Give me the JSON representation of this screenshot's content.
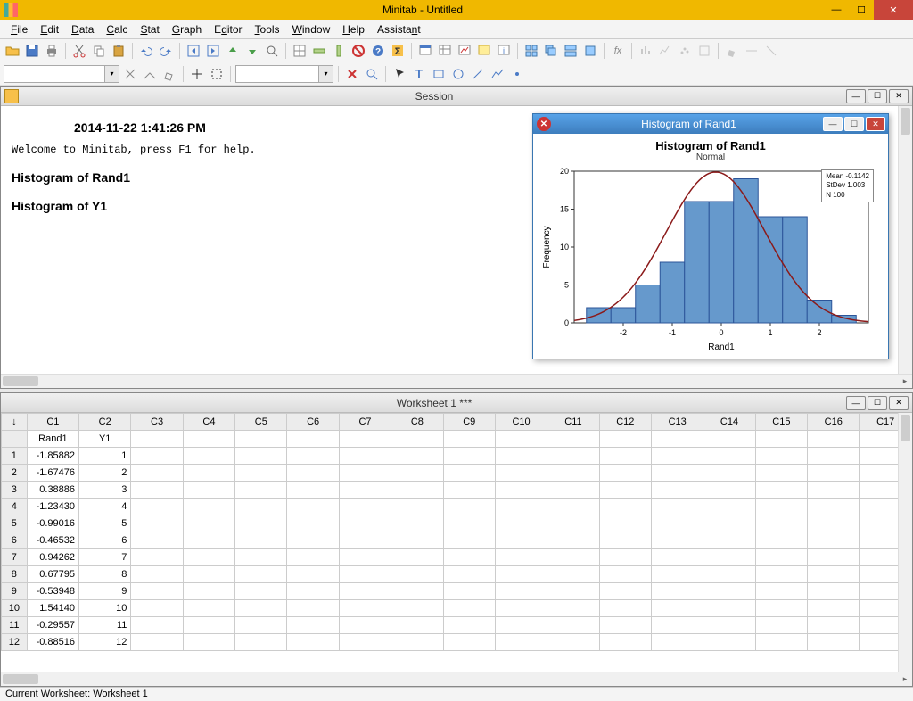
{
  "app": {
    "title": "Minitab - Untitled"
  },
  "menu": [
    "File",
    "Edit",
    "Data",
    "Calc",
    "Stat",
    "Graph",
    "Editor",
    "Tools",
    "Window",
    "Help",
    "Assistant"
  ],
  "session": {
    "title": "Session",
    "timestamp": "2014-11-22 1:41:26 PM",
    "welcome": "Welcome to Minitab, press F1 for help.",
    "h1": "Histogram of Rand1",
    "h2": "Histogram of Y1"
  },
  "chart_window": {
    "title": "Histogram of Rand1"
  },
  "chart_data": {
    "type": "bar",
    "title": "Histogram of Rand1",
    "subtitle": "Normal",
    "xlabel": "Rand1",
    "ylabel": "Frequency",
    "ylim": [
      0,
      20
    ],
    "yticks": [
      0,
      5,
      10,
      15,
      20
    ],
    "xticks": [
      -2,
      -1,
      0,
      1,
      2
    ],
    "categories": [
      -2.5,
      -2.0,
      -1.5,
      -1.0,
      -0.5,
      0.0,
      0.5,
      1.0,
      1.5,
      2.0,
      2.5
    ],
    "values": [
      2,
      2,
      5,
      8,
      16,
      16,
      19,
      14,
      14,
      3,
      1
    ],
    "legend": {
      "Mean": "-0.1142",
      "StDev": "1.003",
      "N": "100"
    },
    "overlay": "normal_curve"
  },
  "worksheet": {
    "title": "Worksheet 1 ***",
    "columns": [
      "C1",
      "C2",
      "C3",
      "C4",
      "C5",
      "C6",
      "C7",
      "C8",
      "C9",
      "C10",
      "C11",
      "C12",
      "C13",
      "C14",
      "C15",
      "C16",
      "C17"
    ],
    "names": [
      "Rand1",
      "Y1",
      "",
      "",
      "",
      "",
      "",
      "",
      "",
      "",
      "",
      "",
      "",
      "",
      "",
      "",
      ""
    ],
    "rows": [
      [
        "-1.85882",
        "1"
      ],
      [
        "-1.67476",
        "2"
      ],
      [
        "0.38886",
        "3"
      ],
      [
        "-1.23430",
        "4"
      ],
      [
        "-0.99016",
        "5"
      ],
      [
        "-0.46532",
        "6"
      ],
      [
        "0.94262",
        "7"
      ],
      [
        "0.67795",
        "8"
      ],
      [
        "-0.53948",
        "9"
      ],
      [
        "1.54140",
        "10"
      ],
      [
        "-0.29557",
        "11"
      ],
      [
        "-0.88516",
        "12"
      ]
    ]
  },
  "status": "Current Worksheet: Worksheet 1"
}
